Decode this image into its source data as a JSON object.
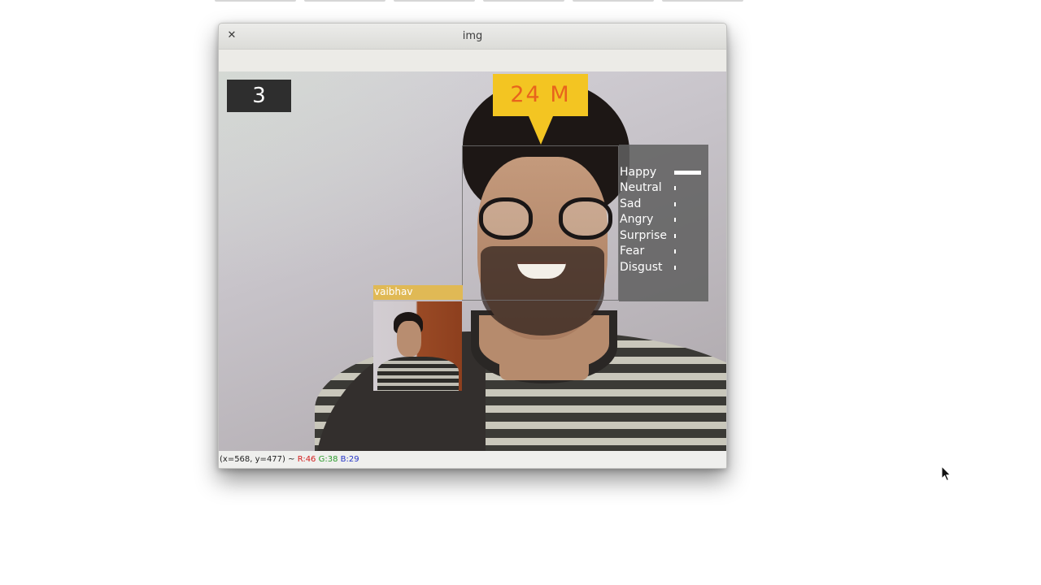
{
  "window": {
    "title": "img"
  },
  "overlay": {
    "counter": "3",
    "age_gender": "24 M",
    "person_name": "vaibhav",
    "emotions": [
      {
        "label": "Happy",
        "level": 1.0
      },
      {
        "label": "Neutral",
        "level": 0.06
      },
      {
        "label": "Sad",
        "level": 0.03
      },
      {
        "label": "Angry",
        "level": 0.03
      },
      {
        "label": "Surprise",
        "level": 0.03
      },
      {
        "label": "Fear",
        "level": 0.03
      },
      {
        "label": "Disgust",
        "level": 0.03
      }
    ]
  },
  "status": {
    "coords": "(x=568, y=477) ~",
    "r": "R:46",
    "g": "G:38",
    "b": "B:29"
  },
  "icons": {
    "close": "close-icon",
    "cursor": "mouse-cursor-icon"
  },
  "colors": {
    "tag_yellow": "#f3c522",
    "tag_text": "#e8641c",
    "name_tag": "#e0b955"
  }
}
